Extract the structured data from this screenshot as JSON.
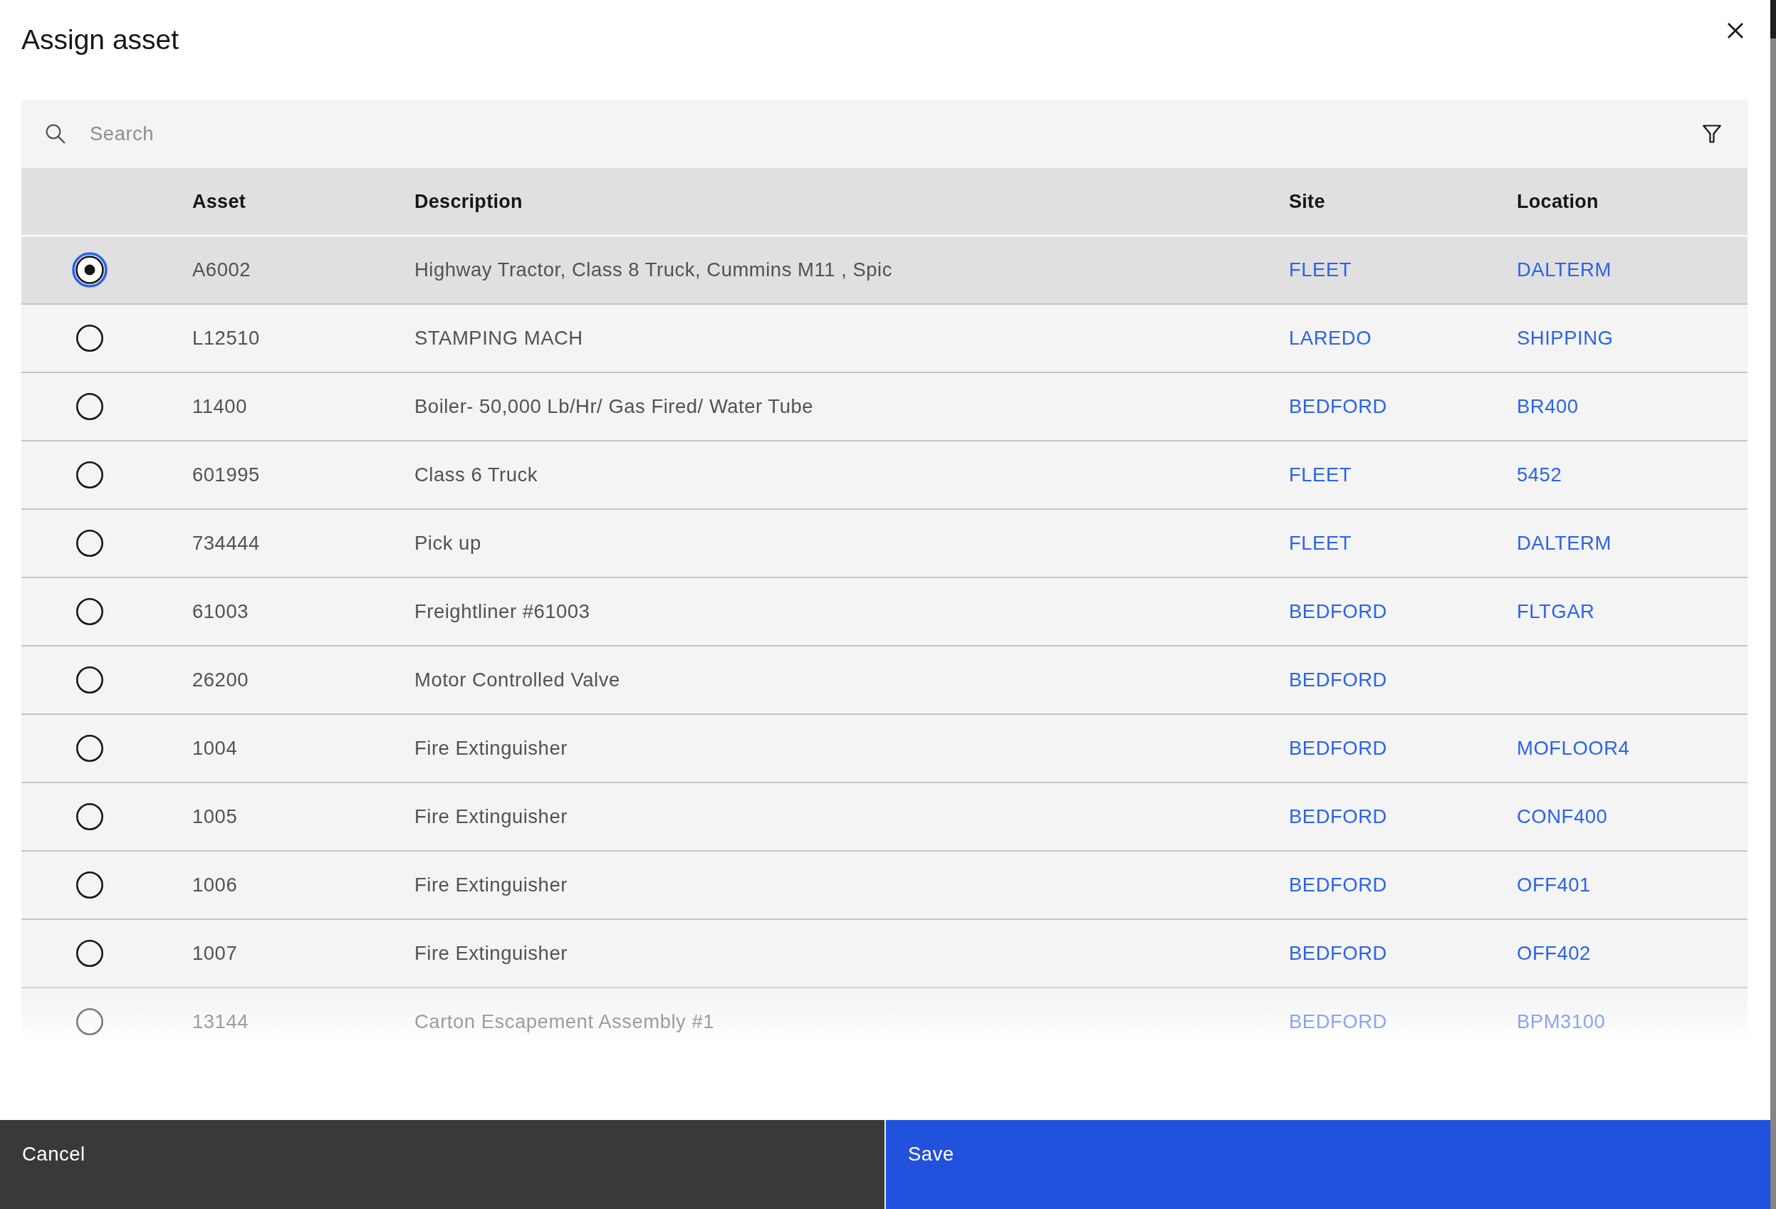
{
  "dialog": {
    "title": "Assign asset"
  },
  "search": {
    "placeholder": "Search"
  },
  "table": {
    "columns": [
      "Asset",
      "Description",
      "Site",
      "Location"
    ],
    "rows": [
      {
        "selected": true,
        "asset": "A6002",
        "description": "Highway Tractor, Class 8 Truck, Cummins M11 , Spic",
        "site": "FLEET",
        "location": "DALTERM"
      },
      {
        "selected": false,
        "asset": "L12510",
        "description": "STAMPING MACH",
        "site": "LAREDO",
        "location": "SHIPPING"
      },
      {
        "selected": false,
        "asset": "11400",
        "description": "Boiler- 50,000 Lb/Hr/ Gas Fired/ Water Tube",
        "site": "BEDFORD",
        "location": "BR400"
      },
      {
        "selected": false,
        "asset": "601995",
        "description": "Class 6 Truck",
        "site": "FLEET",
        "location": "5452"
      },
      {
        "selected": false,
        "asset": "734444",
        "description": "Pick up",
        "site": "FLEET",
        "location": "DALTERM"
      },
      {
        "selected": false,
        "asset": "61003",
        "description": "Freightliner #61003",
        "site": "BEDFORD",
        "location": "FLTGAR"
      },
      {
        "selected": false,
        "asset": "26200",
        "description": "Motor Controlled Valve",
        "site": "BEDFORD"
      },
      {
        "selected": false,
        "asset": "1004",
        "description": "Fire Extinguisher",
        "site": "BEDFORD",
        "location": "MOFLOOR4"
      },
      {
        "selected": false,
        "asset": "1005",
        "description": "Fire Extinguisher",
        "site": "BEDFORD",
        "location": "CONF400"
      },
      {
        "selected": false,
        "asset": "1006",
        "description": "Fire Extinguisher",
        "site": "BEDFORD",
        "location": "OFF401"
      },
      {
        "selected": false,
        "asset": "1007",
        "description": "Fire Extinguisher",
        "site": "BEDFORD",
        "location": "OFF402"
      },
      {
        "selected": false,
        "asset": "13144",
        "description": "Carton Escapement Assembly #1",
        "site": "BEDFORD",
        "location": "BPM3100"
      }
    ]
  },
  "buttons": [
    {
      "label": "Cancel",
      "kind": "secondary"
    },
    {
      "label": "Save",
      "kind": "primary"
    }
  ]
}
